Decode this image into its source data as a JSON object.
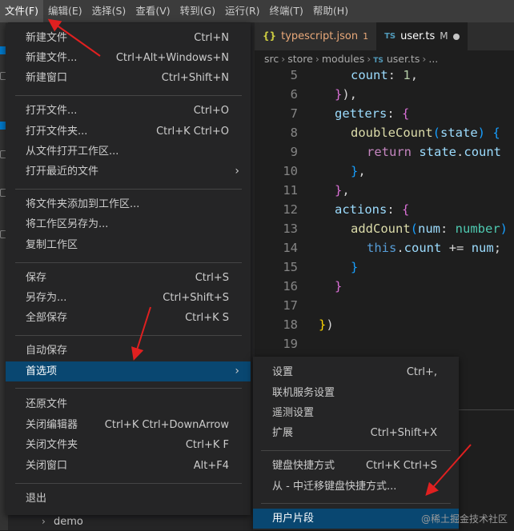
{
  "menubar": [
    "文件(F)",
    "编辑(E)",
    "选择(S)",
    "查看(V)",
    "转到(G)",
    "运行(R)",
    "终端(T)",
    "帮助(H)"
  ],
  "tabs": [
    {
      "icon": "{}",
      "label": "typescript.json",
      "badge": "1"
    },
    {
      "icon": "TS",
      "label": "user.ts",
      "badge": "M"
    }
  ],
  "breadcrumb": {
    "p1": "src",
    "p2": "store",
    "p3": "modules",
    "icon": "TS",
    "file": "user.ts",
    "more": "..."
  },
  "code": {
    "line_numbers": [
      "5",
      "6",
      "7",
      "8",
      "9",
      "10",
      "11",
      "12",
      "13",
      "14",
      "15",
      "16",
      "17",
      "18",
      "19"
    ],
    "l5_prop": "count",
    "l5_val": "1",
    "l7_kw": "getters",
    "l8_fn": "doubleCount",
    "l8_param": "state",
    "l9_kw": "return",
    "l9_obj": "state",
    "l9_prop": "count",
    "l12_kw": "actions",
    "l13_fn": "addCount",
    "l13_param": "num",
    "l13_type": "number",
    "l14_this": "this",
    "l14_prop": "count",
    "l14_op": "+=",
    "l14_var": "num"
  },
  "file_menu": {
    "items": [
      {
        "label": "新建文件",
        "shortcut": "Ctrl+N"
      },
      {
        "label": "新建文件...",
        "shortcut": "Ctrl+Alt+Windows+N"
      },
      {
        "label": "新建窗口",
        "shortcut": "Ctrl+Shift+N"
      },
      {
        "label": "打开文件...",
        "shortcut": "Ctrl+O"
      },
      {
        "label": "打开文件夹...",
        "shortcut": "Ctrl+K Ctrl+O"
      },
      {
        "label": "从文件打开工作区...",
        "shortcut": ""
      },
      {
        "label": "打开最近的文件",
        "shortcut": ""
      },
      {
        "label": "将文件夹添加到工作区...",
        "shortcut": ""
      },
      {
        "label": "将工作区另存为...",
        "shortcut": ""
      },
      {
        "label": "复制工作区",
        "shortcut": ""
      },
      {
        "label": "保存",
        "shortcut": "Ctrl+S"
      },
      {
        "label": "另存为...",
        "shortcut": "Ctrl+Shift+S"
      },
      {
        "label": "全部保存",
        "shortcut": "Ctrl+K S"
      },
      {
        "label": "自动保存",
        "shortcut": ""
      },
      {
        "label": "首选项",
        "shortcut": ""
      },
      {
        "label": "还原文件",
        "shortcut": ""
      },
      {
        "label": "关闭编辑器",
        "shortcut": "Ctrl+K Ctrl+DownArrow"
      },
      {
        "label": "关闭文件夹",
        "shortcut": "Ctrl+K F"
      },
      {
        "label": "关闭窗口",
        "shortcut": "Alt+F4"
      },
      {
        "label": "退出",
        "shortcut": ""
      }
    ]
  },
  "submenu": {
    "items": [
      {
        "label": "设置",
        "shortcut": "Ctrl+,"
      },
      {
        "label": "联机服务设置",
        "shortcut": ""
      },
      {
        "label": "遥测设置",
        "shortcut": ""
      },
      {
        "label": "扩展",
        "shortcut": "Ctrl+Shift+X"
      },
      {
        "label": "键盘快捷方式",
        "shortcut": "Ctrl+K Ctrl+S"
      },
      {
        "label": "从 - 中迁移键盘快捷方式...",
        "shortcut": ""
      },
      {
        "label": "用户片段",
        "shortcut": ""
      }
    ]
  },
  "sidebar": {
    "folder": "demo"
  },
  "watermark": "@稀土掘金技术社区",
  "colors": {
    "menu_bg": "#252526",
    "selected": "#094771",
    "arrow": "#e02020",
    "menubar": "#3c3c3c"
  }
}
